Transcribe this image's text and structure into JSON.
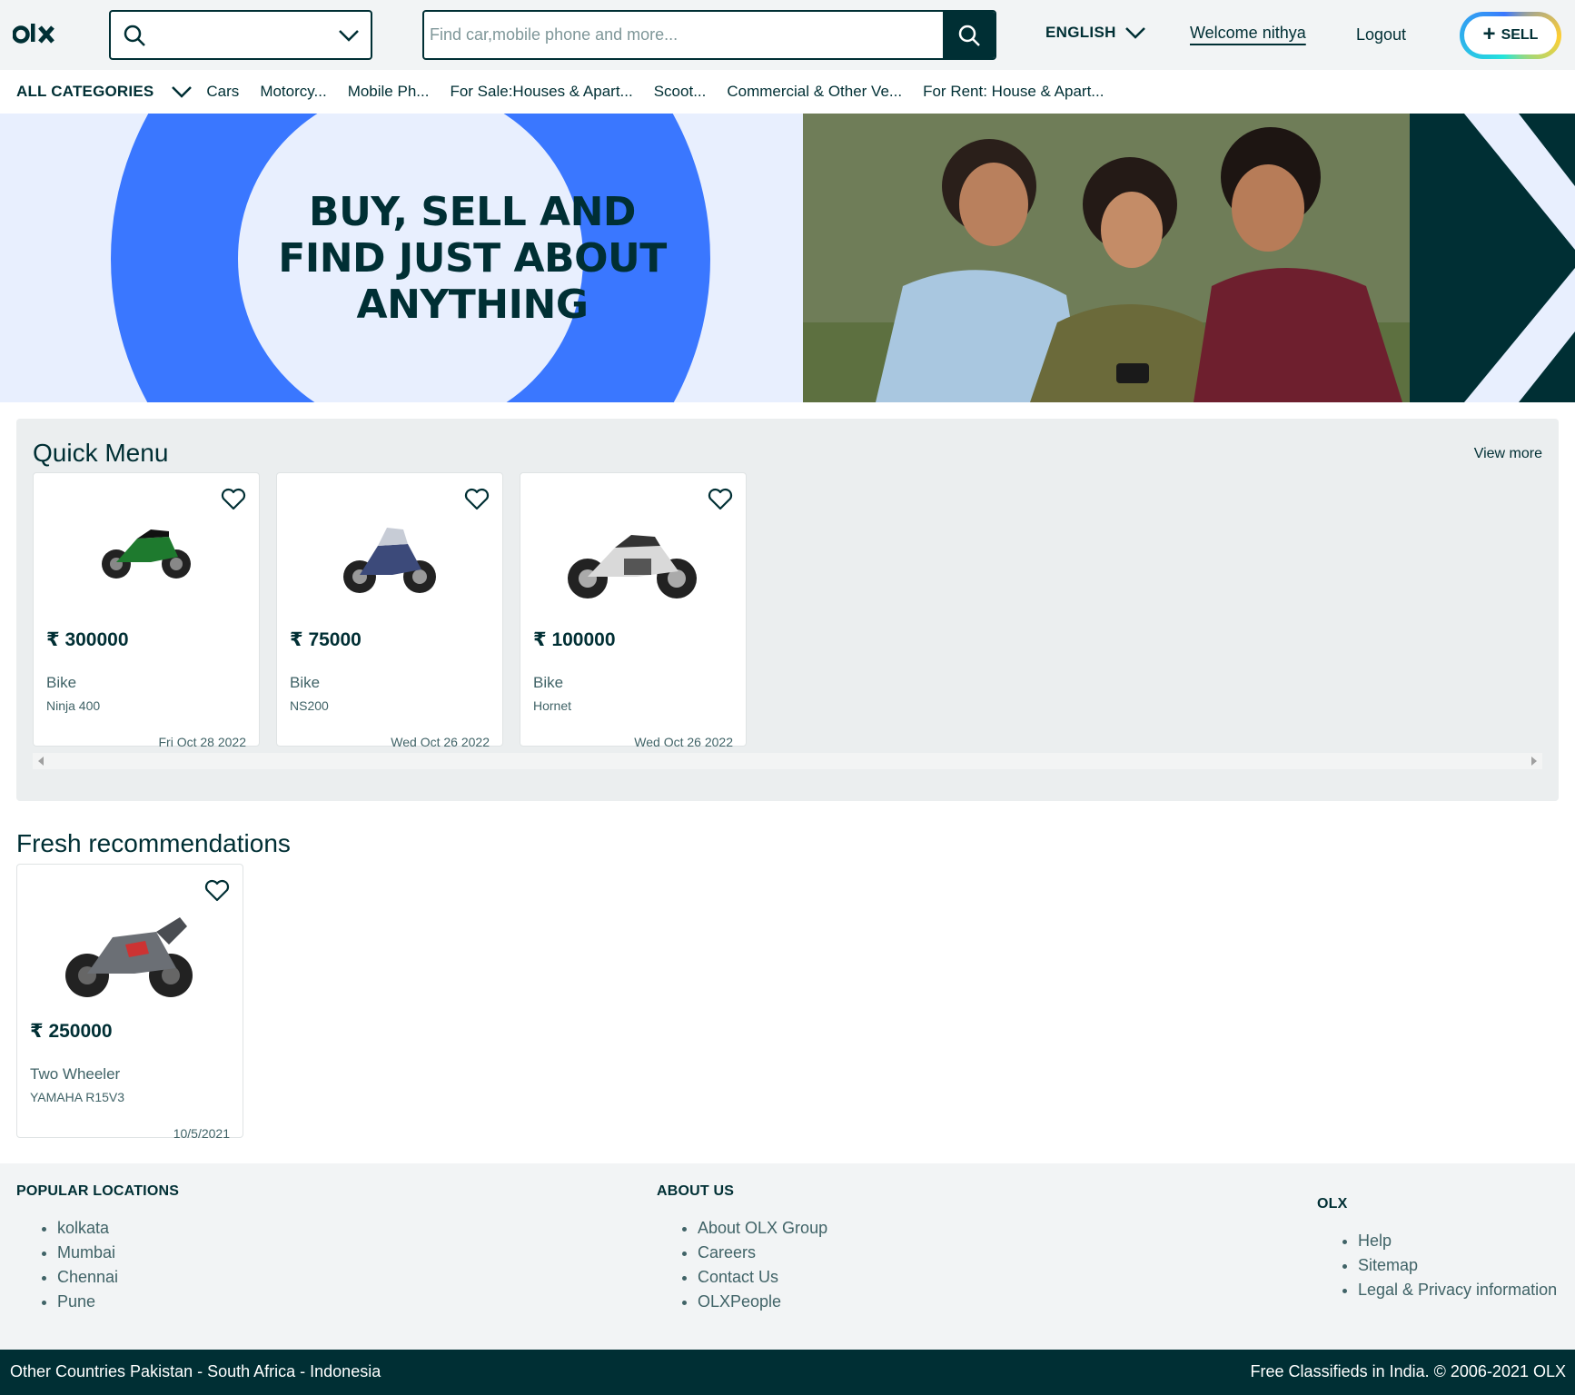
{
  "header": {
    "location_value": "",
    "search_placeholder": "Find car,mobile phone and more...",
    "language": "ENGLISH",
    "welcome": "Welcome nithya",
    "logout": "Logout",
    "sell_label": "SELL",
    "sell_plus": "+"
  },
  "categories": {
    "all_label": "ALL CATEGORIES",
    "items": [
      "Cars",
      "Motorcy...",
      "Mobile Ph...",
      "For Sale:Houses & Apart...",
      "Scoot...",
      "Commercial & Other Ve...",
      "For Rent: House & Apart..."
    ]
  },
  "banner": {
    "line1": "BUY, SELL AND",
    "line2": "FIND JUST ABOUT",
    "line3": "ANYTHING"
  },
  "quick_menu": {
    "title": "Quick Menu",
    "view_more": "View more",
    "cards": [
      {
        "price": "₹ 300000",
        "type": "Bike",
        "name": "Ninja 400",
        "date": "Fri Oct 28 2022",
        "color": "#1e7a2e"
      },
      {
        "price": "₹ 75000",
        "type": "Bike",
        "name": "NS200",
        "date": "Wed Oct 26 2022",
        "color": "#3c4a7a"
      },
      {
        "price": "₹ 100000",
        "type": "Bike",
        "name": "Hornet",
        "date": "Wed Oct 26 2022",
        "color": "#c9c9c9"
      }
    ]
  },
  "fresh": {
    "title": "Fresh recommendations",
    "cards": [
      {
        "price": "₹ 250000",
        "type": "Two Wheeler",
        "name": "YAMAHA R15V3",
        "date": "10/5/2021",
        "color": "#6b6f75"
      }
    ]
  },
  "footer": {
    "popular": {
      "title": "POPULAR LOCATIONS",
      "items": [
        "kolkata",
        "Mumbai",
        "Chennai",
        "Pune"
      ]
    },
    "about": {
      "title": "ABOUT US",
      "items": [
        "About OLX Group",
        "Careers",
        "Contact Us",
        "OLXPeople"
      ]
    },
    "olx": {
      "title": "OLX",
      "items": [
        "Help",
        "Sitemap",
        "Legal & Privacy information"
      ]
    },
    "bottom_left": "Other Countries Pakistan - South Africa - Indonesia",
    "bottom_right": "Free Classifieds in India. © 2006-2021 OLX"
  },
  "colors": {
    "brand_dark": "#002f34",
    "accent_blue": "#3a77ff",
    "background_grey": "#ebeeef"
  },
  "icons": [
    "olx-logo",
    "search-icon",
    "chevron-down-icon",
    "heart-icon",
    "plus-icon"
  ]
}
